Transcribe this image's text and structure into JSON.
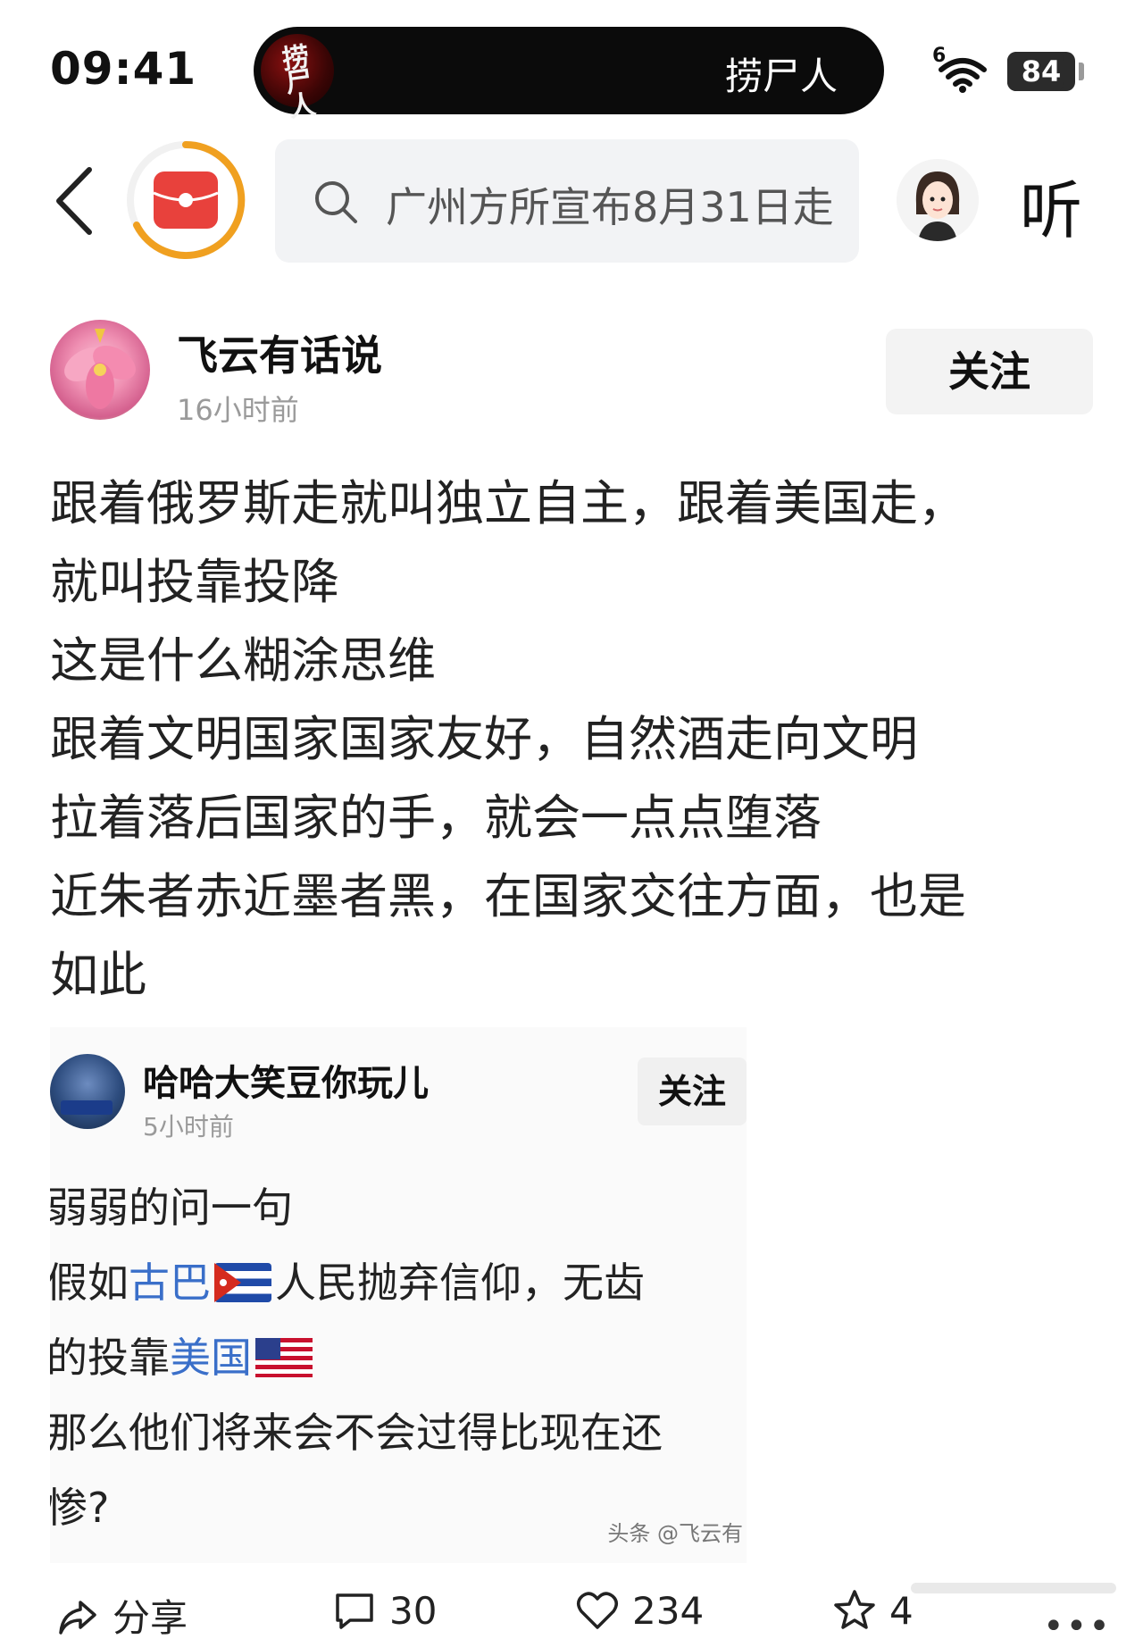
{
  "status_bar": {
    "time": "09:41",
    "network": "6",
    "battery": "84",
    "battery_level": 0.84,
    "island_logo_text": "捞尸人",
    "island_text": "捞尸人"
  },
  "header": {
    "search_text": "广州方所宣布8月31日走",
    "listen_label": "听"
  },
  "post": {
    "author": "飞云有话说",
    "time": "16小时前",
    "follow_label": "关注",
    "lines": [
      "跟着俄罗斯走就叫独立自主，跟着美国走，",
      "就叫投靠投降",
      "这是什么糊涂思维",
      "跟着文明国家国家友好，自然酒走向文明",
      "拉着落后国家的手，就会一点点堕落",
      "近朱者赤近墨者黑，在国家交往方面，也是",
      "如此"
    ]
  },
  "embed": {
    "author": "哈哈大笑豆你玩儿",
    "time": "5小时前",
    "follow_label": "关注",
    "line1": "弱弱的问一句",
    "line2_prefix": "假如",
    "line2_link": "古巴",
    "line2_suffix": "人民抛弃信仰，无齿",
    "line3_prefix": "的投靠",
    "line3_link": "美国",
    "line4": "那么他们将来会不会过得比现在还",
    "line5": "惨?",
    "watermark": "头条 @飞云有"
  },
  "actions": {
    "share": "分享",
    "comments": "30",
    "likes": "234",
    "favorites": "4"
  },
  "colors": {
    "link": "#3a6fc9",
    "ring": "#f0a020",
    "redpacket": "#e8413c"
  }
}
